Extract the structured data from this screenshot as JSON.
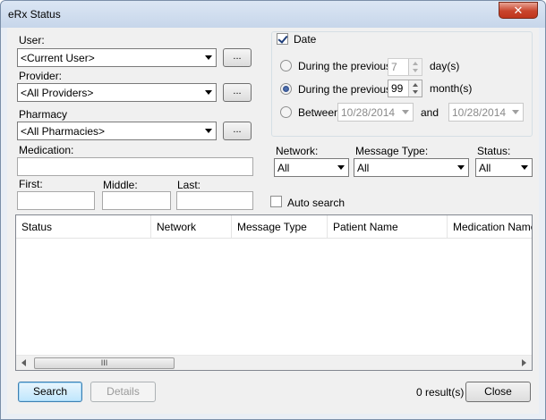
{
  "window": {
    "title": "eRx Status",
    "close_symbol": "✕"
  },
  "filters": {
    "user": {
      "label": "User:",
      "value": "<Current User>"
    },
    "provider": {
      "label": "Provider:",
      "value": "<All Providers>"
    },
    "pharmacy": {
      "label": "Pharmacy",
      "value": "<All Pharmacies>"
    },
    "browse_label": "...",
    "medication": {
      "label": "Medication:",
      "value": ""
    },
    "first": {
      "label": "First:",
      "value": ""
    },
    "middle": {
      "label": "Middle:",
      "value": ""
    },
    "last": {
      "label": "Last:",
      "value": ""
    }
  },
  "date": {
    "label": "Date",
    "checked": true,
    "previous_days": {
      "label": "During the previous",
      "value": "7",
      "unit": "day(s)",
      "selected": false
    },
    "previous_months": {
      "label": "During the previous",
      "value": "99",
      "unit": "month(s)",
      "selected": true
    },
    "between": {
      "label": "Between",
      "from": "10/28/2014",
      "and_label": "and",
      "to": "10/28/2014",
      "selected": false
    }
  },
  "network": {
    "label": "Network:",
    "value": "All"
  },
  "message_type": {
    "label": "Message Type:",
    "value": "All"
  },
  "status": {
    "label": "Status:",
    "value": "All"
  },
  "auto_search": {
    "label": "Auto search",
    "checked": false
  },
  "grid": {
    "columns": [
      "Status",
      "Network",
      "Message Type",
      "Patient Name",
      "Medication Name"
    ],
    "rows": [],
    "scroll_thumb_label": "III"
  },
  "footer": {
    "search_label": "Search",
    "details_label": "Details",
    "result_count": "0 result(s)",
    "close_label": "Close"
  }
}
